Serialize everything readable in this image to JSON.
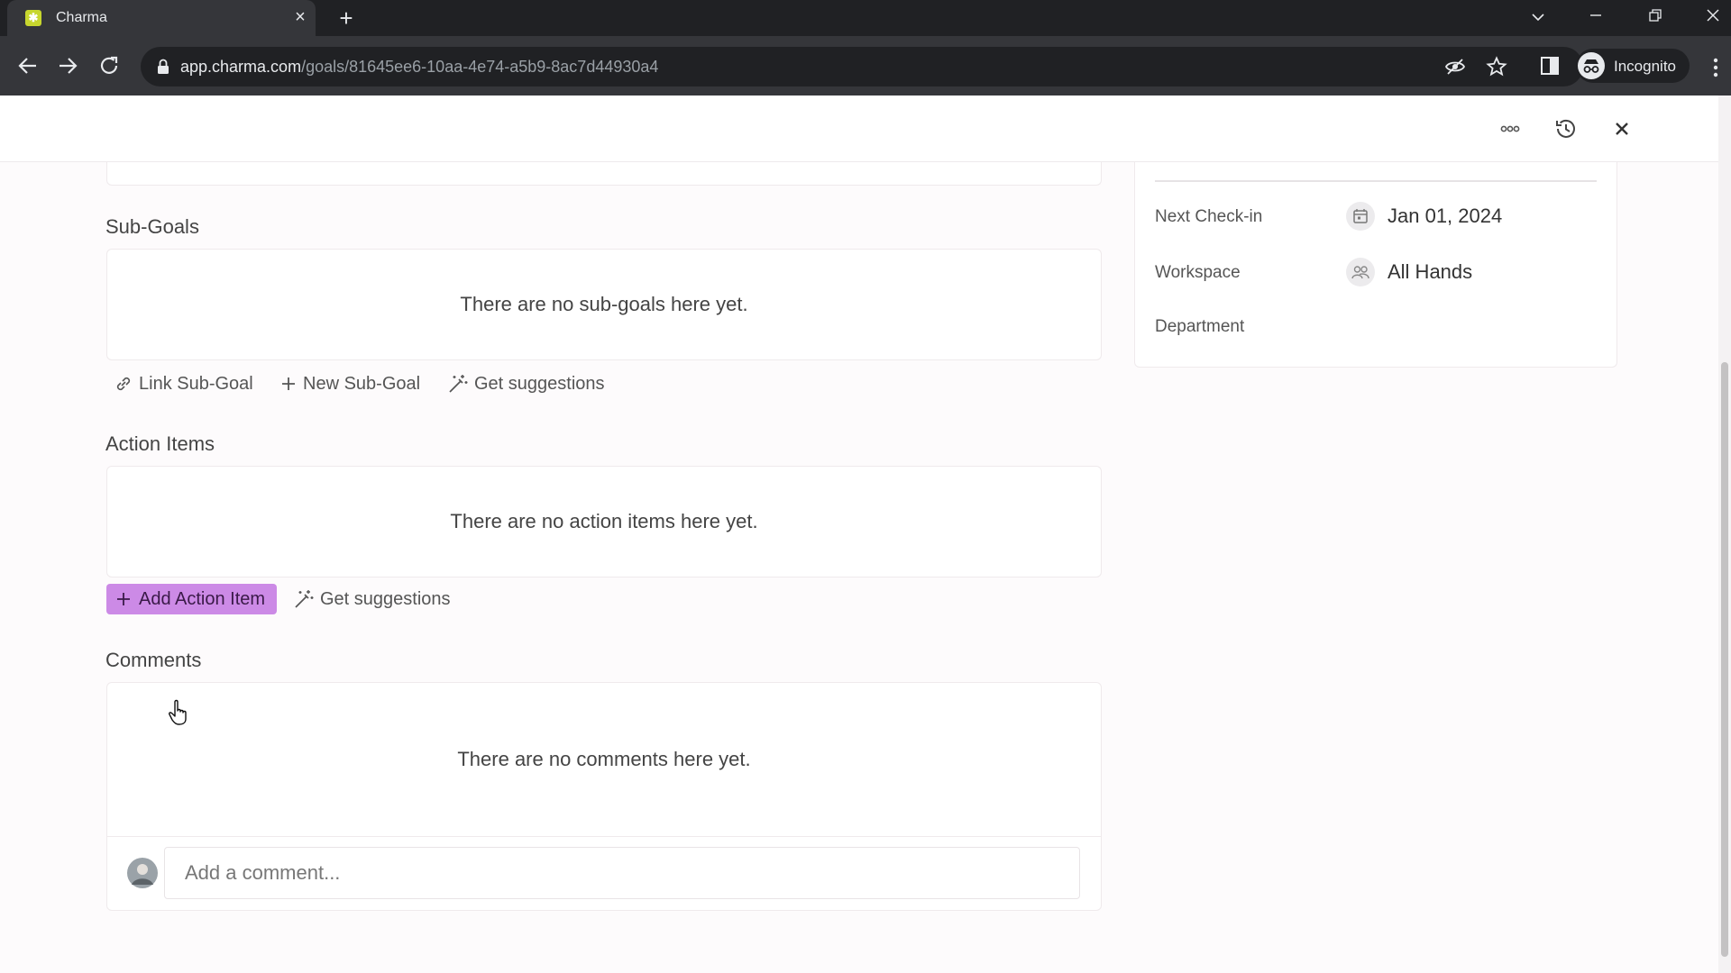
{
  "browser": {
    "tab_title": "Charma",
    "url_host": "app.charma.com",
    "url_path": "/goals/81645ee6-10aa-4e74-a5b9-8ac7d44930a4",
    "incognito_label": "Incognito"
  },
  "sections": {
    "subgoals": {
      "title": "Sub-Goals",
      "empty_text": "There are no sub-goals here yet.",
      "link_label": "Link Sub-Goal",
      "new_label": "New Sub-Goal",
      "suggest_label": "Get suggestions"
    },
    "action_items": {
      "title": "Action Items",
      "empty_text": "There are no action items here yet.",
      "add_label": "Add Action Item",
      "suggest_label": "Get suggestions"
    },
    "comments": {
      "title": "Comments",
      "empty_text": "There are no comments here yet.",
      "placeholder": "Add a comment..."
    }
  },
  "sidebar": {
    "next_checkin": {
      "label": "Next Check-in",
      "value": "Jan 01, 2024"
    },
    "workspace": {
      "label": "Workspace",
      "value": "All Hands"
    },
    "department": {
      "label": "Department"
    }
  },
  "colors": {
    "accent": "#cc8ae6",
    "tab_favicon": "#c7d62e"
  }
}
